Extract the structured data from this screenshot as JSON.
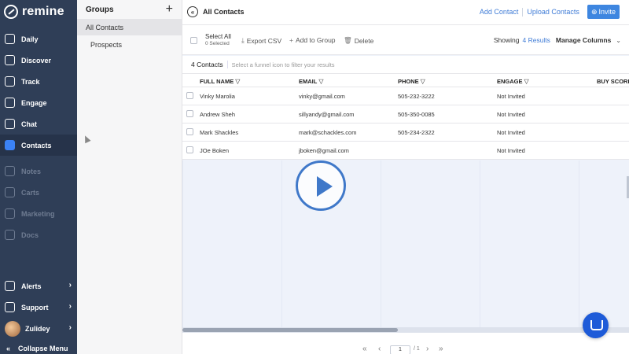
{
  "app": {
    "logo_text": "remine"
  },
  "sidebar": {
    "items": [
      {
        "label": "Daily",
        "icon": "coffee-icon",
        "state": "normal"
      },
      {
        "label": "Discover",
        "icon": "map-icon",
        "state": "normal"
      },
      {
        "label": "Track",
        "icon": "star-icon",
        "state": "normal"
      },
      {
        "label": "Engage",
        "icon": "people-icon",
        "state": "normal"
      },
      {
        "label": "Chat",
        "icon": "chat-icon",
        "state": "normal"
      },
      {
        "label": "Contacts",
        "icon": "contacts-icon",
        "state": "active"
      },
      {
        "label": "Notes",
        "icon": "notes-icon",
        "state": "disabled"
      },
      {
        "label": "Carts",
        "icon": "cart-icon",
        "state": "disabled"
      },
      {
        "label": "Marketing",
        "icon": "megaphone-icon",
        "state": "disabled"
      },
      {
        "label": "Docs",
        "icon": "document-icon",
        "state": "disabled"
      }
    ],
    "bottom": [
      {
        "label": "Alerts",
        "icon": "bell-icon"
      },
      {
        "label": "Support",
        "icon": "headset-icon"
      },
      {
        "label": "Zulidey",
        "icon": "avatar"
      }
    ],
    "collapse_label": "Collapse Menu"
  },
  "groups": {
    "title": "Groups",
    "items": [
      "All Contacts",
      "Prospects"
    ],
    "selected": "All Contacts"
  },
  "header": {
    "title": "All Contacts",
    "add_contact": "Add Contact",
    "upload_contacts": "Upload Contacts",
    "invite": "Invite"
  },
  "toolbar": {
    "select_all": "Select All",
    "selected_count": "0 Selected",
    "export_csv": "Export CSV",
    "add_to_group": "Add to Group",
    "delete": "Delete",
    "showing_label": "Showing",
    "results": "4 Results",
    "manage_columns": "Manage Columns"
  },
  "filter": {
    "count": "4 Contacts",
    "hint": "Select a funnel icon to filter your results"
  },
  "table": {
    "columns": [
      "FULL NAME",
      "EMAIL",
      "PHONE",
      "ENGAGE",
      "BUY SCORE"
    ],
    "rows": [
      {
        "name": "Vinky Marolia",
        "email": "vinky@gmail.com",
        "phone": "505-232-3222",
        "engage": "Not Invited"
      },
      {
        "name": "Andrew Sheh",
        "email": "sillyandy@gmail.com",
        "phone": "505-350-0085",
        "engage": "Not Invited"
      },
      {
        "name": "Mark Shackles",
        "email": "mark@schackles.com",
        "phone": "505-234-2322",
        "engage": "Not Invited"
      },
      {
        "name": "JOe Boken",
        "email": "jboken@gmail.com",
        "phone": "",
        "engage": "Not Invited"
      }
    ]
  },
  "pagination": {
    "page": "1",
    "of": "/ 1"
  },
  "colors": {
    "sidebar": "#2f3e57",
    "accent": "#3e86e0",
    "play": "#3f78c9",
    "chat": "#1e5bd8"
  }
}
